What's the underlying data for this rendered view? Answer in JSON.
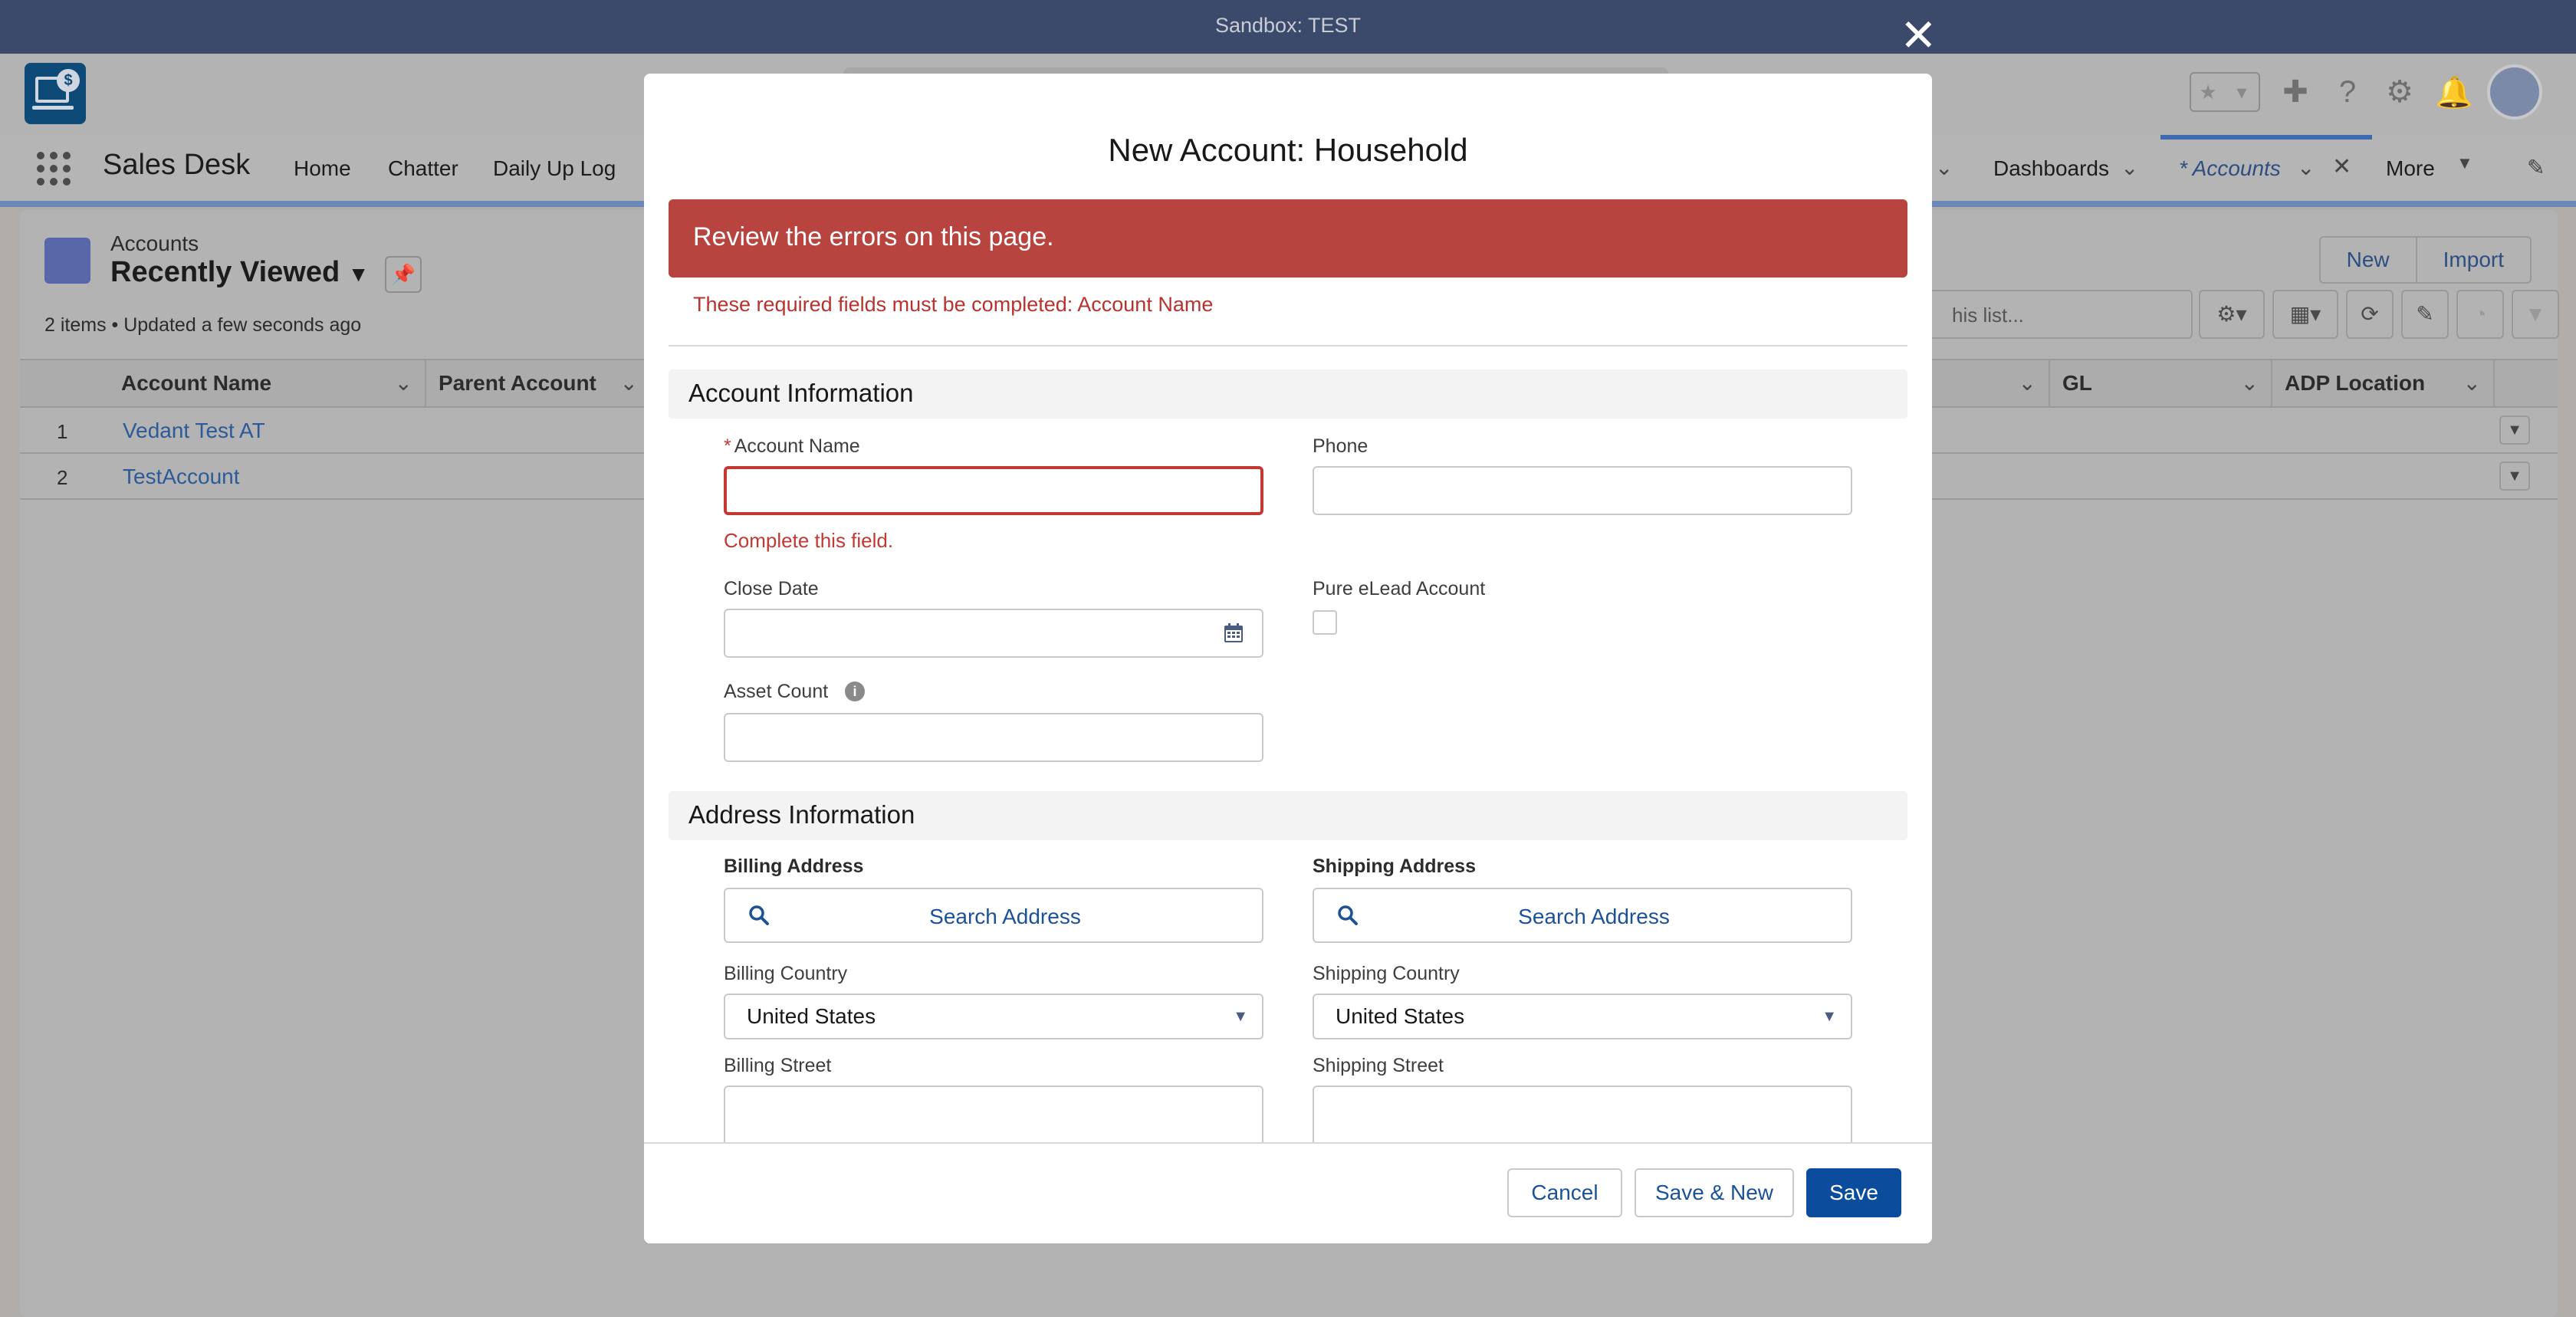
{
  "sandbox": {
    "label": "Sandbox: TEST"
  },
  "app": {
    "name": "Sales Desk",
    "nav": [
      {
        "label": "Home"
      },
      {
        "label": "Chatter"
      },
      {
        "label": "Daily Up Log"
      },
      {
        "label": "Dashboards"
      },
      {
        "label": "* Accounts"
      },
      {
        "label": "More"
      }
    ]
  },
  "list_view": {
    "object": "Accounts",
    "view_name": "Recently Viewed",
    "meta": "2 items • Updated a few seconds ago",
    "buttons": {
      "new": "New",
      "import": "Import"
    },
    "search_placeholder": "his list...",
    "columns": [
      "Account Name",
      "Parent Account",
      "GL",
      "ADP Location"
    ],
    "rows": [
      {
        "num": "1",
        "name": "Vedant Test AT"
      },
      {
        "num": "2",
        "name": "TestAccount"
      }
    ]
  },
  "modal": {
    "title": "New Account: Household",
    "error_banner": "Review the errors on this page.",
    "error_required": "These required fields must be completed: Account Name",
    "sections": {
      "account_info": "Account Information",
      "address_info": "Address Information"
    },
    "fields": {
      "account_name": {
        "label": "Account Name",
        "required_mark": "*",
        "value": "",
        "error": "Complete this field."
      },
      "phone": {
        "label": "Phone",
        "value": ""
      },
      "close_date": {
        "label": "Close Date",
        "value": ""
      },
      "pure_elead": {
        "label": "Pure eLead Account",
        "checked": false
      },
      "asset_count": {
        "label": "Asset Count",
        "value": ""
      },
      "billing_address": {
        "label": "Billing Address",
        "search_label": "Search Address"
      },
      "shipping_address": {
        "label": "Shipping Address",
        "search_label": "Search Address"
      },
      "billing_country": {
        "label": "Billing Country",
        "value": "United States"
      },
      "shipping_country": {
        "label": "Shipping Country",
        "value": "United States"
      },
      "billing_street": {
        "label": "Billing Street",
        "value": ""
      },
      "shipping_street": {
        "label": "Shipping Street",
        "value": ""
      }
    },
    "footer": {
      "cancel": "Cancel",
      "save_new": "Save & New",
      "save": "Save"
    }
  },
  "colors": {
    "error_banner": "#b84440",
    "error_text": "#c23934",
    "brand_button": "#0b4d9c",
    "link": "#1b5297"
  }
}
